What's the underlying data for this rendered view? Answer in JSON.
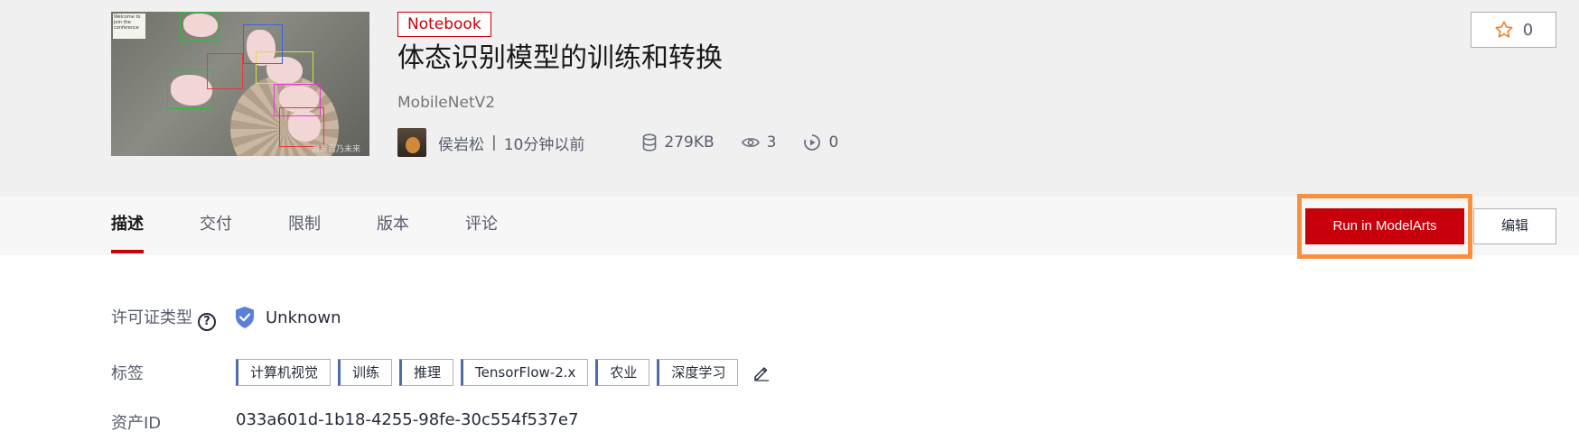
{
  "header": {
    "thumbnail_alt": "pig detection sample",
    "thumbnail_note": "Welcome to join the conference",
    "thumbnail_watermark": "激发百乃未来",
    "badge": "Notebook",
    "title": "体态识别模型的训练和转换",
    "subtitle": "MobileNetV2",
    "author": "侯岩松",
    "separator": "|",
    "time": "10分钟以前",
    "size": "279KB",
    "views": "3",
    "runs": "0",
    "star_count": "0"
  },
  "tabs": [
    {
      "label": "描述",
      "active": true
    },
    {
      "label": "交付",
      "active": false
    },
    {
      "label": "限制",
      "active": false
    },
    {
      "label": "版本",
      "active": false
    },
    {
      "label": "评论",
      "active": false
    }
  ],
  "actions": {
    "run_label": "Run in ModelArts",
    "edit_label": "编辑"
  },
  "details": {
    "license_label": "许可证类型",
    "help_glyph": "?",
    "license_value": "Unknown",
    "tags_label": "标签",
    "tags": [
      "计算机视觉",
      "训练",
      "推理",
      "TensorFlow-2.x",
      "农业",
      "深度学习"
    ],
    "asset_label": "资产ID",
    "asset_id": "033a601d-1b18-4255-98fe-30c554f537e7"
  },
  "colors": {
    "brand_red": "#c7000b",
    "highlight_orange": "#f7913f",
    "tag_accent": "#4e6ca8"
  },
  "icons": {
    "size": "database-icon",
    "views": "eye-icon",
    "runs": "play-circle-icon",
    "star": "star-icon",
    "license": "shield-check-icon",
    "help": "question-circle-icon",
    "edit_tags": "pencil-icon"
  }
}
